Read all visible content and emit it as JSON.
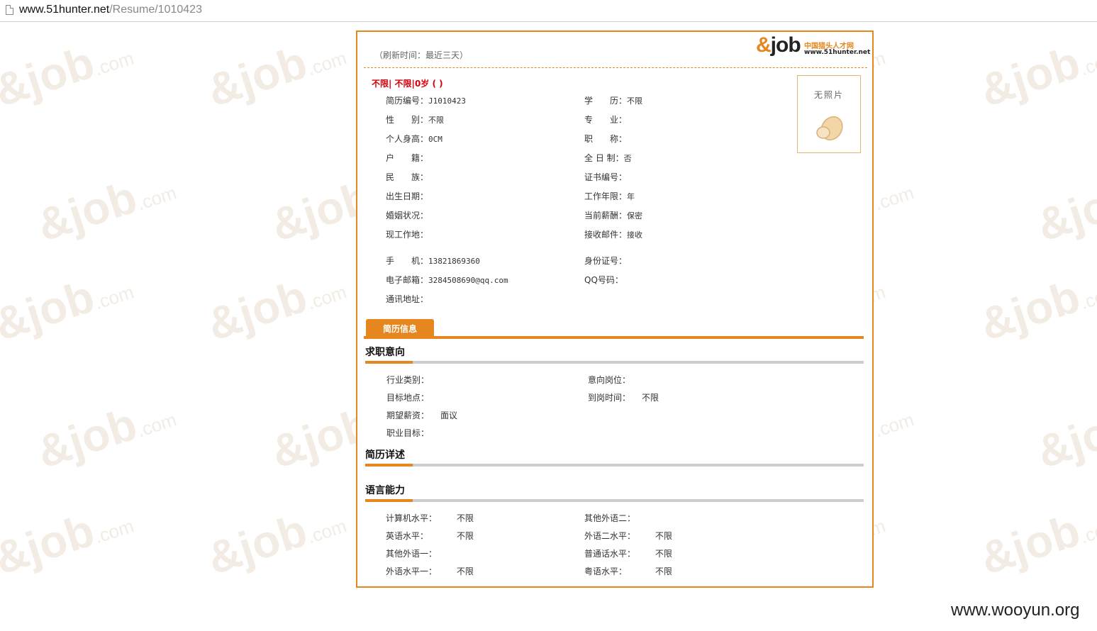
{
  "address_bar": {
    "host": "www.51hunter.net",
    "path": "/Resume/1010423"
  },
  "watermark": {
    "brand": "job",
    "suffix": ".com"
  },
  "logo": {
    "brand": "job",
    "cn_name": "中国猎头人才网",
    "url": "www.51hunter.net"
  },
  "resume": {
    "refresh": "（刷新时间：最近三天）",
    "headline": "不限| 不限|0岁 ( )",
    "photo_label": "无照片",
    "basic_left": [
      {
        "label": "简历编号：",
        "value": "J1010423"
      },
      {
        "label": "性　　别：",
        "value": "不限"
      },
      {
        "label": "个人身高：",
        "value": "0CM"
      },
      {
        "label": "户　　籍：",
        "value": ""
      },
      {
        "label": "民　　族：",
        "value": ""
      },
      {
        "label": "出生日期：",
        "value": ""
      },
      {
        "label": "婚姻状况：",
        "value": ""
      },
      {
        "label": "现工作地：",
        "value": ""
      }
    ],
    "basic_right": [
      {
        "label": "学　　历：",
        "value": "不限"
      },
      {
        "label": "专　　业：",
        "value": ""
      },
      {
        "label": "职　　称：",
        "value": ""
      },
      {
        "label": "全 日 制：",
        "value": "否"
      },
      {
        "label": "证书编号：",
        "value": ""
      },
      {
        "label": "工作年限：",
        "value": "年"
      },
      {
        "label": "当前薪酬：",
        "value": "保密"
      },
      {
        "label": "接收邮件：",
        "value": "接收"
      }
    ],
    "contact_left": [
      {
        "label": "手　　机：",
        "value": "13821869360"
      },
      {
        "label": "电子邮箱：",
        "value": "3284508690@qq.com"
      },
      {
        "label": "通讯地址：",
        "value": ""
      }
    ],
    "contact_right": [
      {
        "label": "身份证号：",
        "value": ""
      },
      {
        "label": "QQ号码：",
        "value": ""
      }
    ],
    "tab_label": "简历信息",
    "sections": {
      "job_intent": {
        "title": "求职意向",
        "left": [
          {
            "label": "行业类别：",
            "value": ""
          },
          {
            "label": "目标地点：",
            "value": ""
          },
          {
            "label": "期望薪资：",
            "value": "面议"
          },
          {
            "label": "职业目标：",
            "value": ""
          }
        ],
        "right": [
          {
            "label": "意向岗位：",
            "value": ""
          },
          {
            "label": "到岗时间：",
            "value": "不限"
          }
        ]
      },
      "detail": {
        "title": "简历详述"
      },
      "language": {
        "title": "语言能力",
        "left": [
          {
            "label": "计算机水平：",
            "value": "不限"
          },
          {
            "label": "英语水平：",
            "value": "不限"
          },
          {
            "label": "其他外语一：",
            "value": ""
          },
          {
            "label": "外语水平一：",
            "value": "不限"
          }
        ],
        "right": [
          {
            "label": "其他外语二：",
            "value": ""
          },
          {
            "label": "外语二水平：",
            "value": "不限"
          },
          {
            "label": "普通话水平：",
            "value": "不限"
          },
          {
            "label": "粤语水平：",
            "value": "不限"
          }
        ]
      }
    }
  },
  "footer_watermark": "www.wooyun.org",
  "colors": {
    "accent": "#e5861e",
    "headline": "#d8000c",
    "bar_gray": "#cccccc"
  }
}
